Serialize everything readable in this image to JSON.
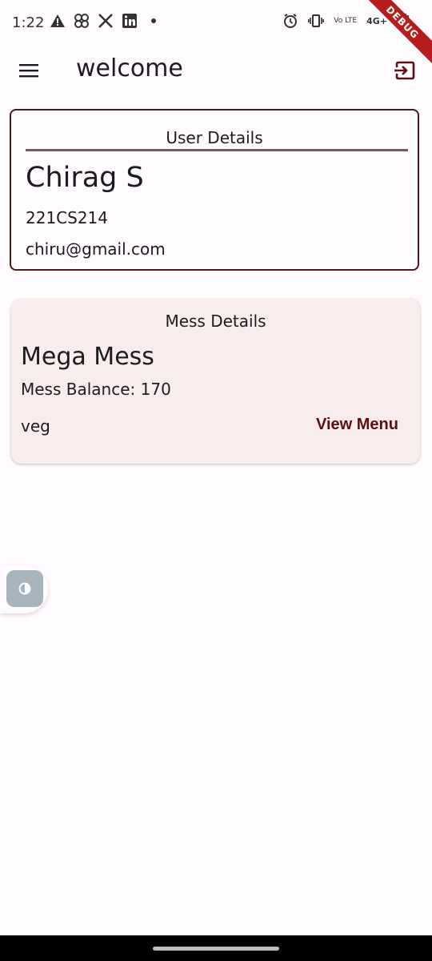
{
  "status_bar": {
    "time": "1:22",
    "left_icons": [
      "warning-icon",
      "pinwheel-icon",
      "x-logo-icon",
      "linkedin-icon",
      "dot-icon"
    ],
    "right_icons": [
      "alarm-icon",
      "vibrate-icon",
      "volte-icon",
      "network-4g-icon",
      "battery-icon"
    ],
    "lte_label": "Vo LTE",
    "network_label": "4G+",
    "debug_banner": "DEBUG"
  },
  "app_bar": {
    "title": "welcome"
  },
  "user_card": {
    "heading": "User Details",
    "name": "Chirag S",
    "roll_no": "221CS214",
    "email": "chiru@gmail.com"
  },
  "mess_card": {
    "heading": "Mess Details",
    "mess_name": "Mega Mess",
    "balance_text": "Mess Balance: 170",
    "food_type": "veg",
    "view_menu_label": "View Menu"
  },
  "colors": {
    "background": "#fffbfe",
    "card_border": "#4a1a1a",
    "mess_card_bg": "#f8eced",
    "accent": "#5a1010",
    "toggle_bg": "#a7b3bd",
    "debug_banner": "#b71c1c"
  }
}
